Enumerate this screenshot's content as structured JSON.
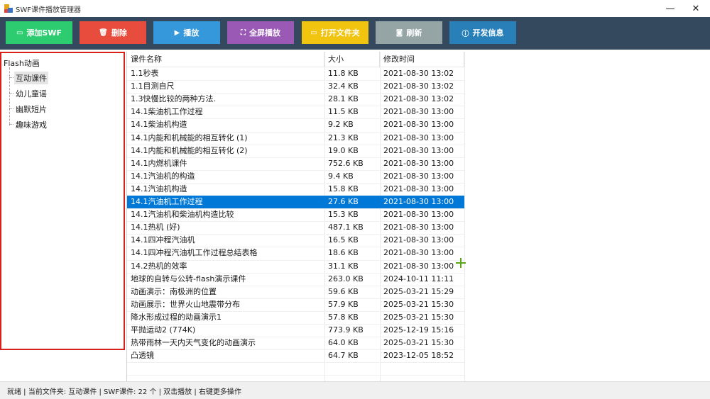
{
  "window": {
    "title": "SWF课件播放管理器",
    "minimize": "—",
    "close": "✕"
  },
  "toolbar": {
    "buttons": [
      {
        "label": "添加SWF",
        "icon": "▭",
        "color": "#2ecc71"
      },
      {
        "label": "删除",
        "icon": "🗑",
        "color": "#e74c3c"
      },
      {
        "label": "播放",
        "icon": "▶",
        "color": "#3498db"
      },
      {
        "label": "全屏播放",
        "icon": "⛶",
        "color": "#9b59b6"
      },
      {
        "label": "打开文件夹",
        "icon": "▭",
        "color": "#f1c40f"
      },
      {
        "label": "刷新",
        "icon": "◙",
        "color": "#95a5a6"
      },
      {
        "label": "开发信息",
        "icon": "ⓘ",
        "color": "#2980b9"
      }
    ]
  },
  "tree": {
    "root": "Flash动画",
    "items": [
      "互动课件",
      "幼儿童谣",
      "幽默短片",
      "趣味游戏"
    ],
    "selected_index": 0
  },
  "list": {
    "columns": [
      "课件名称",
      "大小",
      "修改时间"
    ],
    "selected_index": 10,
    "rows": [
      {
        "name": "1.1秒表",
        "size": "11.8 KB",
        "time": "2021-08-30 13:02"
      },
      {
        "name": "1.1目测自尺",
        "size": "32.4 KB",
        "time": "2021-08-30 13:02"
      },
      {
        "name": "1.3快慢比较的两种方法.",
        "size": "28.1 KB",
        "time": "2021-08-30 13:02"
      },
      {
        "name": "14.1柴油机工作过程",
        "size": "11.5 KB",
        "time": "2021-08-30 13:00"
      },
      {
        "name": "14.1柴油机构造",
        "size": "9.2 KB",
        "time": "2021-08-30 13:00"
      },
      {
        "name": "14.1内能和机械能的相互转化 (1)",
        "size": "21.3 KB",
        "time": "2021-08-30 13:00"
      },
      {
        "name": "14.1内能和机械能的相互转化 (2)",
        "size": "19.0 KB",
        "time": "2021-08-30 13:00"
      },
      {
        "name": "14.1内燃机课件",
        "size": "752.6 KB",
        "time": "2021-08-30 13:00"
      },
      {
        "name": "14.1汽油机的构造",
        "size": "9.4 KB",
        "time": "2021-08-30 13:00"
      },
      {
        "name": "14.1汽油机构造",
        "size": "15.8 KB",
        "time": "2021-08-30 13:00"
      },
      {
        "name": "14.1汽油机工作过程",
        "size": "27.6 KB",
        "time": "2021-08-30 13:00"
      },
      {
        "name": "14.1汽油机和柴油机构造比较",
        "size": "15.3 KB",
        "time": "2021-08-30 13:00"
      },
      {
        "name": "14.1热机 (好)",
        "size": "487.1 KB",
        "time": "2021-08-30 13:00"
      },
      {
        "name": "14.1四冲程汽油机",
        "size": "16.5 KB",
        "time": "2021-08-30 13:00"
      },
      {
        "name": "14.1四冲程汽油机工作过程总结表格",
        "size": "18.6 KB",
        "time": "2021-08-30 13:00"
      },
      {
        "name": "14.2热机的效率",
        "size": "31.1 KB",
        "time": "2021-08-30 13:00"
      },
      {
        "name": "地球的自转与公转-flash演示课件",
        "size": "263.0 KB",
        "time": "2024-10-11 11:11"
      },
      {
        "name": "动画演示：南极洲的位置",
        "size": "59.6 KB",
        "time": "2025-03-21 15:29"
      },
      {
        "name": "动画展示：世界火山地震带分布",
        "size": "57.9 KB",
        "time": "2025-03-21 15:30"
      },
      {
        "name": "降水形成过程的动画演示1",
        "size": "57.8 KB",
        "time": "2025-03-21 15:30"
      },
      {
        "name": "平抛运动2 (774K)",
        "size": "773.9 KB",
        "time": "2025-12-19 15:16"
      },
      {
        "name": "热带雨林一天内天气变化的动画演示",
        "size": "64.0 KB",
        "time": "2025-03-21 15:30"
      },
      {
        "name": "凸透镜",
        "size": "64.7 KB",
        "time": "2023-12-05 18:52"
      }
    ]
  },
  "status": {
    "text": "就绪 | 当前文件夹: 互动课件 | SWF课件: 22 个 | 双击播放 | 右键更多操作"
  }
}
